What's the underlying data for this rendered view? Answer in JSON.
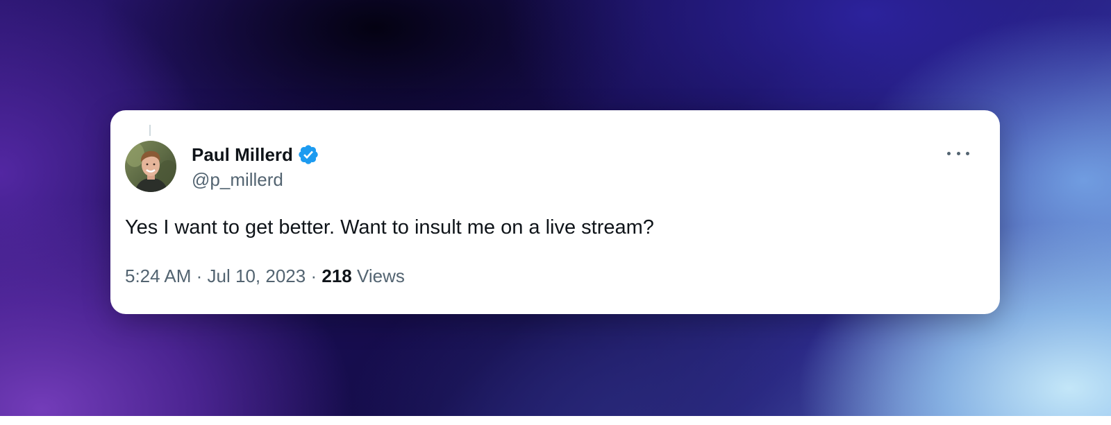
{
  "tweet": {
    "author_name": "Paul Millerd",
    "author_handle": "@p_millerd",
    "verified": true,
    "verified_icon": "verified-badge-icon",
    "avatar_icon": "user-avatar",
    "more_icon": "more-options-icon",
    "text": "Yes I want to get better. Want to insult me on a live stream?",
    "time": "5:24 AM",
    "separator": "·",
    "date": "Jul 10, 2023",
    "views_count": "218",
    "views_label": "Views"
  },
  "colors": {
    "verified_blue": "#1d9bf0",
    "primary_text": "#0f1419",
    "secondary_text": "#536471",
    "card_background": "#ffffff"
  }
}
